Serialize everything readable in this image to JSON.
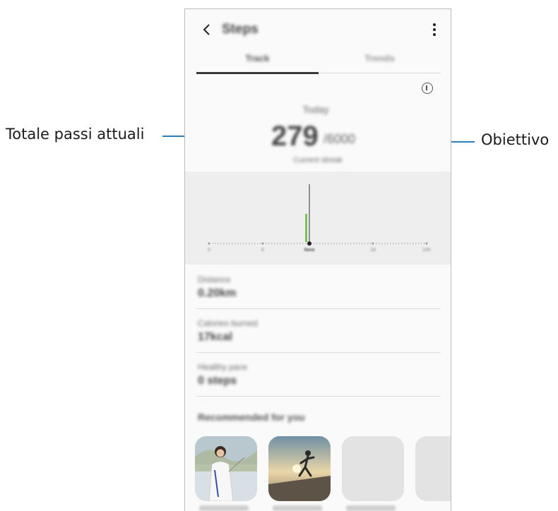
{
  "callouts": {
    "left_label": "Totale passi attuali",
    "right_label": "Obiettivo"
  },
  "header": {
    "title": "Steps"
  },
  "tabs": [
    {
      "label": "Track"
    },
    {
      "label": "Trends"
    }
  ],
  "summary": {
    "today_label": "Today",
    "steps_count": "279",
    "steps_goal": "/6000",
    "caption": "Current streak"
  },
  "chart_axis_ticks": [
    "0",
    "6",
    "Now",
    "18",
    "24h"
  ],
  "stats": [
    {
      "label": "Distance",
      "value": "0.20km"
    },
    {
      "label": "Calories burned",
      "value": "17kcal"
    },
    {
      "label": "Healthy pace",
      "value": "0 steps"
    }
  ],
  "recommended": {
    "title": "Recommended for you"
  },
  "colors": {
    "accent_line": "#2a7fb8",
    "bar_green": "#7cc05a"
  }
}
